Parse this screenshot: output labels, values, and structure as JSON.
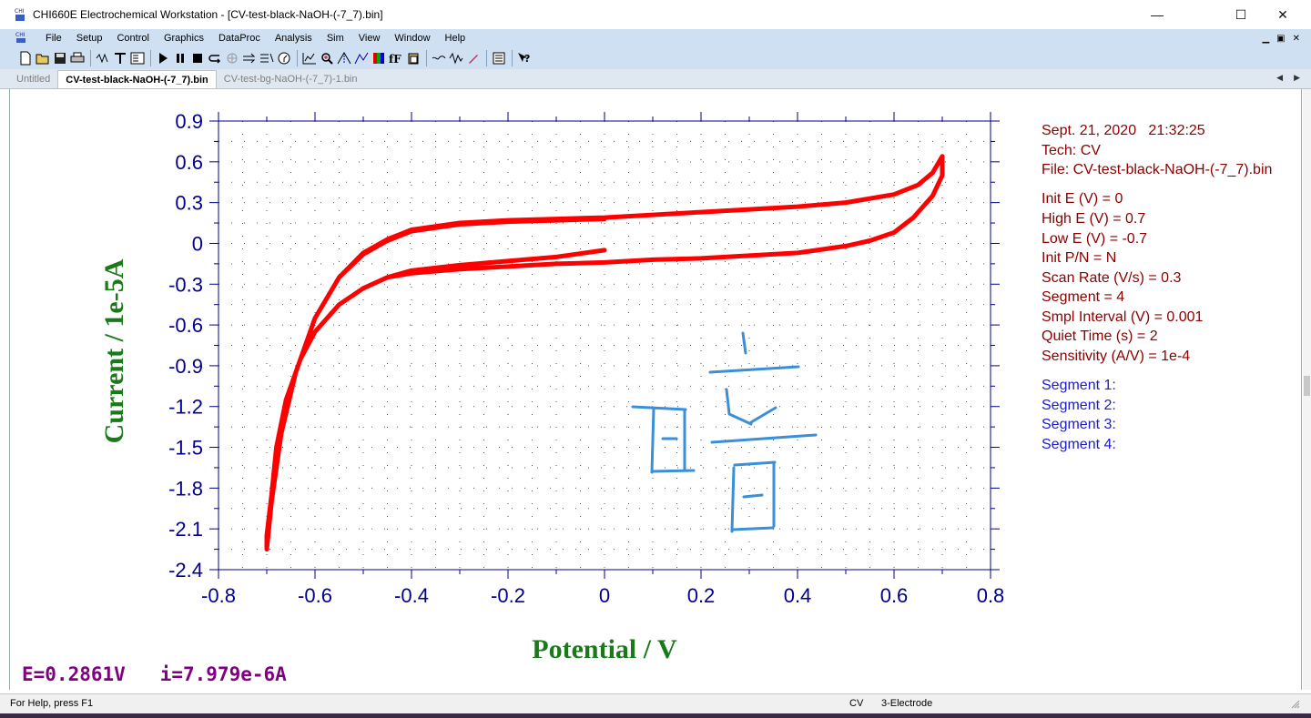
{
  "window": {
    "title": "CHI660E Electrochemical Workstation - [CV-test-black-NaOH-(-7_7).bin]",
    "minimize_glyph": "—",
    "maximize_glyph": "☐",
    "close_glyph": "✕"
  },
  "menu": {
    "items": [
      "File",
      "Setup",
      "Control",
      "Graphics",
      "DataProc",
      "Analysis",
      "Sim",
      "View",
      "Window",
      "Help"
    ],
    "mdi_controls": [
      "▁",
      "▣",
      "✕"
    ]
  },
  "toolbar": {
    "icons": [
      "new-file-icon",
      "open-folder-icon",
      "save-icon",
      "print-icon",
      "technique-icon",
      "text-icon",
      "parameters-icon",
      "run-icon",
      "pause-icon",
      "stop-icon",
      "reverse-scan-icon",
      "stir-icon",
      "purge-icon",
      "ir-comp-icon",
      "timer-icon",
      "present-data-icon",
      "zoom-icon",
      "peak-icon",
      "graph-options-icon",
      "color-icon",
      "font-icon",
      "copy-to-clipboard-icon",
      "smooth-icon",
      "derivative-icon",
      "pen-icon",
      "reports-icon",
      "help-icon"
    ]
  },
  "tabs": [
    {
      "label": "Untitled",
      "active": false
    },
    {
      "label": "CV-test-black-NaOH-(-7_7).bin",
      "active": true
    },
    {
      "label": "CV-test-bg-NaOH-(-7_7)-1.bin",
      "active": false
    }
  ],
  "tab_scroll": [
    "◀",
    "▶"
  ],
  "plot": {
    "xlabel": "Potential / V",
    "ylabel": "Current / 1e-5A",
    "x_ticks": [
      "-0.8",
      "-0.6",
      "-0.4",
      "-0.2",
      "0",
      "0.2",
      "0.4",
      "0.6",
      "0.8"
    ],
    "y_ticks": [
      "0.9",
      "0.6",
      "0.3",
      "0",
      "-0.3",
      "-0.6",
      "-0.9",
      "-1.2",
      "-1.5",
      "-1.8",
      "-2.1",
      "-2.4"
    ],
    "xlim": [
      -0.8,
      0.8
    ],
    "ylim": [
      -2.4,
      0.9
    ],
    "grid": true,
    "curve_color": "#ff0000",
    "axis_color": "#00008b",
    "label_color": "#1a7a1a"
  },
  "chart_data": {
    "type": "line",
    "xlabel": "Potential / V",
    "ylabel": "Current / 1e-5A",
    "xlim": [
      -0.8,
      0.8
    ],
    "ylim": [
      -2.4,
      0.9
    ],
    "grid": true,
    "series": [
      {
        "x": [
          0.0,
          -0.1,
          -0.2,
          -0.3,
          -0.35,
          -0.4,
          -0.45,
          -0.5,
          -0.55,
          -0.6,
          -0.63,
          -0.66,
          -0.68,
          -0.69,
          -0.7,
          -0.7,
          -0.69,
          -0.67,
          -0.64,
          -0.6,
          -0.55,
          -0.5,
          -0.45,
          -0.4,
          -0.3,
          -0.2,
          -0.1,
          0.0,
          0.1,
          0.2,
          0.3,
          0.4,
          0.5,
          0.6,
          0.65,
          0.68,
          0.7,
          0.7,
          0.68,
          0.64,
          0.6,
          0.55,
          0.5,
          0.4,
          0.3,
          0.2,
          0.1,
          0.0,
          -0.1,
          -0.2,
          -0.3,
          -0.4,
          -0.45,
          -0.5,
          -0.55,
          -0.6,
          -0.63,
          -0.66,
          -0.68,
          -0.69,
          -0.7,
          -0.7,
          -0.69,
          -0.67,
          -0.64,
          -0.6,
          -0.55,
          -0.5,
          -0.45,
          -0.4,
          -0.3,
          -0.2,
          -0.1,
          0.0
        ],
        "y": [
          -0.05,
          -0.1,
          -0.13,
          -0.16,
          -0.18,
          -0.2,
          -0.25,
          -0.33,
          -0.45,
          -0.65,
          -0.85,
          -1.15,
          -1.5,
          -1.85,
          -2.15,
          -2.25,
          -1.9,
          -1.4,
          -0.95,
          -0.55,
          -0.25,
          -0.07,
          0.03,
          0.1,
          0.15,
          0.17,
          0.18,
          0.19,
          0.21,
          0.23,
          0.25,
          0.27,
          0.3,
          0.36,
          0.43,
          0.52,
          0.64,
          0.5,
          0.35,
          0.19,
          0.08,
          0.02,
          -0.02,
          -0.07,
          -0.09,
          -0.11,
          -0.12,
          -0.14,
          -0.15,
          -0.17,
          -0.19,
          -0.22,
          -0.25,
          -0.33,
          -0.45,
          -0.65,
          -0.85,
          -1.15,
          -1.5,
          -1.85,
          -2.15,
          -2.25,
          -1.9,
          -1.4,
          -0.95,
          -0.55,
          -0.25,
          -0.08,
          0.02,
          0.09,
          0.14,
          0.16,
          0.17,
          0.18
        ]
      }
    ]
  },
  "info": {
    "datetime": "Sept. 21, 2020   21:32:25",
    "tech": "Tech: CV",
    "file": "File: CV-test-black-NaOH-(-7_7).bin",
    "params": [
      "Init E (V) = 0",
      "High E (V) = 0.7",
      "Low E (V) = -0.7",
      "Init P/N = N",
      "Scan Rate (V/s) = 0.3",
      "Segment = 4",
      "Smpl Interval (V) = 0.001",
      "Quiet Time (s) = 2",
      "Sensitivity (A/V) = 1e-4"
    ],
    "segments": [
      "Segment 1:",
      "Segment 2:",
      "Segment 3:",
      "Segment 4:"
    ]
  },
  "readout": "E=0.2861V   i=7.979e-6A",
  "status": {
    "help": "For Help, press F1",
    "technique": "CV",
    "electrode": "3-Electrode"
  },
  "annotation_color": "#3a8fd8"
}
